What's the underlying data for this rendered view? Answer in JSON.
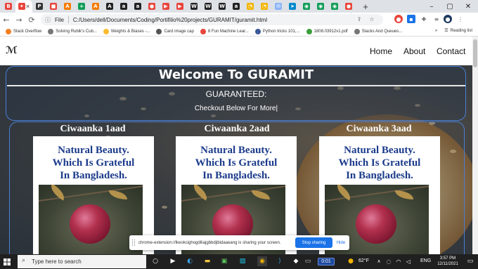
{
  "browser": {
    "tabs": [
      {
        "color": "#e8453c",
        "glyph": "B",
        "active": false
      },
      {
        "color": "#e8453c",
        "glyph": "✦",
        "active": true
      },
      {
        "color": "#333333",
        "glyph": "P",
        "active": false
      },
      {
        "color": "#e8453c",
        "glyph": "■",
        "active": false
      },
      {
        "color": "#f57c00",
        "glyph": "A",
        "active": false
      },
      {
        "color": "#0f9d58",
        "glyph": "+",
        "active": false
      },
      {
        "color": "#f57c00",
        "glyph": "A",
        "active": false
      },
      {
        "color": "#222222",
        "glyph": "A",
        "active": false
      },
      {
        "color": "#222222",
        "glyph": "a",
        "active": false
      },
      {
        "color": "#222222",
        "glyph": "a",
        "active": false
      },
      {
        "color": "#e8453c",
        "glyph": "●",
        "active": false
      },
      {
        "color": "#e8453c",
        "glyph": "▶",
        "active": false
      },
      {
        "color": "#e8453c",
        "glyph": "▶",
        "active": false
      },
      {
        "color": "#222222",
        "glyph": "W",
        "active": false
      },
      {
        "color": "#222222",
        "glyph": "W",
        "active": false
      },
      {
        "color": "#222222",
        "glyph": "W",
        "active": false
      },
      {
        "color": "#222222",
        "glyph": "a",
        "active": false
      },
      {
        "color": "#f4b400",
        "glyph": "◔",
        "active": false
      },
      {
        "color": "#f4b400",
        "glyph": "◔",
        "active": false
      },
      {
        "color": "#8ab4f8",
        "glyph": "✉",
        "active": false
      },
      {
        "color": "#0088cc",
        "glyph": "➤",
        "active": false
      },
      {
        "color": "#0f9d58",
        "glyph": "◉",
        "active": false
      },
      {
        "color": "#0f9d58",
        "glyph": "◉",
        "active": false
      },
      {
        "color": "#0f9d58",
        "glyph": "◉",
        "active": false
      },
      {
        "color": "#e8453c",
        "glyph": "●",
        "active": false
      }
    ],
    "new_tab": "+",
    "window_controls": {
      "minimize": "–",
      "maximize": "▢",
      "close": "✕"
    },
    "nav": {
      "back": "←",
      "forward": "→",
      "reload": "⟳"
    },
    "address": {
      "scheme_label": "File",
      "url": "C:/Users/dell/Documents/Coding/Portifilio%20projects/GURAMIT/guramit.html"
    },
    "bookmarks": [
      {
        "label": "Stack Overflow",
        "color": "#f48024"
      },
      {
        "label": "Solving Rubik's Cub...",
        "color": "#777777"
      },
      {
        "label": "Weights & Biases -...",
        "color": "#fcbc32"
      },
      {
        "label": "Card image cap",
        "color": "#555555"
      },
      {
        "label": "8 Fun Machine Lear...",
        "color": "#e8453c"
      },
      {
        "label": "Python tricks 101,...",
        "color": "#3b5998"
      },
      {
        "label": "1808.03912v1.pdf",
        "color": "#3c9e3c"
      },
      {
        "label": "Stacks And Queues...",
        "color": "#777777"
      }
    ],
    "bookmarks_more": "»",
    "reading_list": "Reading list"
  },
  "site": {
    "logo": "ℳ",
    "nav": [
      "Home",
      "About",
      "Contact"
    ],
    "welcome_title": "Welcome To GURAMIT",
    "guaranteed": "GUARANTEED:",
    "checkout": "Checkout Below For More|",
    "cards": [
      {
        "title": "Ciwaanka 1aad",
        "line1": "Natural Beauty.",
        "line2": "Which Is Grateful",
        "line3": "In Bangladesh."
      },
      {
        "title": "Ciwaanka 2aad",
        "line1": "Natural Beauty.",
        "line2": "Which Is Grateful",
        "line3": "In Bangladesh."
      },
      {
        "title": "Ciwaanka 3aad",
        "line1": "Natural Beauty.",
        "line2": "Which Is Grateful",
        "line3": "In Bangladesh."
      }
    ]
  },
  "share_bar": {
    "message": "chrome-extension://lkeokcighogdliiajgbbdjibidaaeang is sharing your screen.",
    "stop_label": "Stop sharing",
    "hide_label": "Hide"
  },
  "taskbar": {
    "search_placeholder": "Type here to search",
    "timer": "0:01",
    "weather": "62°F",
    "language": "ENG",
    "time": "3:57 PM",
    "date": "12/11/2021"
  }
}
